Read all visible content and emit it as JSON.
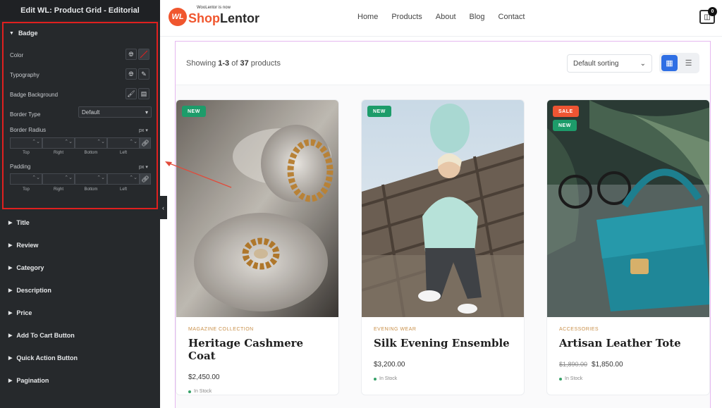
{
  "editor": {
    "title": "Edit WL: Product Grid - Editorial",
    "badge_section": {
      "title": "Badge",
      "color_label": "Color",
      "typography_label": "Typography",
      "badge_background_label": "Badge Background",
      "border_type_label": "Border Type",
      "border_type_value": "Default",
      "border_radius_label": "Border Radius",
      "padding_label": "Padding",
      "unit": "px",
      "dim_labels": [
        "Top",
        "Right",
        "Bottom",
        "Left"
      ]
    },
    "sections": [
      "Title",
      "Review",
      "Category",
      "Description",
      "Price",
      "Add To Cart Button",
      "Quick Action Button",
      "Pagination"
    ]
  },
  "site": {
    "logo_small": "WooLentor is now",
    "logo_mark": "WL",
    "logo_name_a": "Shop",
    "logo_name_b": "Lentor",
    "nav": [
      "Home",
      "Products",
      "About",
      "Blog",
      "Contact"
    ],
    "cart_count": "0"
  },
  "toolbar": {
    "showing_prefix": "Showing ",
    "showing_range": "1-3",
    "showing_of": " of ",
    "showing_total": "37",
    "showing_suffix": " products",
    "sort_value": "Default sorting"
  },
  "products": [
    {
      "category": "MAGAZINE COLLECTION",
      "name": "Heritage Cashmere Coat",
      "price": "$2,450.00",
      "old_price": "",
      "stock": "In Stock",
      "badges": [
        "NEW"
      ]
    },
    {
      "category": "EVENING WEAR",
      "name": "Silk Evening Ensemble",
      "price": "$3,200.00",
      "old_price": "",
      "stock": "In Stock",
      "badges": [
        "NEW"
      ]
    },
    {
      "category": "ACCESSORIES",
      "name": "Artisan Leather Tote",
      "price": "$1,850.00",
      "old_price": "$1,890.00",
      "stock": "In Stock",
      "badges": [
        "SALE",
        "NEW"
      ]
    }
  ],
  "colors": {
    "panel_bg": "#26292c",
    "highlight_border": "#e0201f",
    "brand": "#f0562e",
    "badge_new": "#1d9c6a",
    "badge_sale": "#ee5533",
    "view_active": "#2f6fe4",
    "category_text": "#c9904a"
  }
}
